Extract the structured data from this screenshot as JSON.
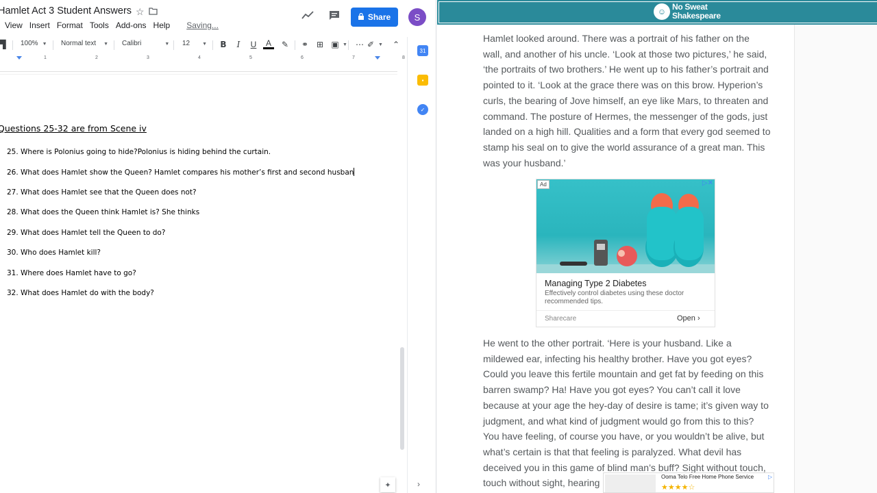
{
  "docs": {
    "title": "Hamlet Act 3 Student Answers",
    "menu": [
      "View",
      "Insert",
      "Format",
      "Tools",
      "Add-ons",
      "Help"
    ],
    "saving": "Saving...",
    "share_label": "Share",
    "avatar_letter": "S",
    "toolbar": {
      "zoom": "100%",
      "style": "Normal text",
      "font": "Calibri",
      "size": "12"
    },
    "ruler_ticks": [
      "1",
      "2",
      "3",
      "4",
      "5",
      "6",
      "7",
      "8"
    ],
    "heading": "Questions 25-32 are from Scene iv",
    "questions": [
      "25. Where is Polonius going to hide?Polonius is hiding behind the curtain.",
      "26. What does Hamlet show the Queen? Hamlet compares his mother’s first and second husban",
      "27. What does Hamlet see that the Queen does not?",
      "28. What does the Queen think Hamlet is? She thinks",
      "29. What does Hamlet tell the Queen to do?",
      "30.  Who does Hamlet kill?",
      "31. Where does Hamlet have to go?",
      "32. What does Hamlet do with the body?"
    ]
  },
  "site": {
    "logo_line1": "No Sweat",
    "logo_line2": "Shakespeare",
    "paragraph1": "Hamlet looked around. There was a portrait of his father on the wall, and another of his uncle. ‘Look at those two pictures,’ he said, ‘the portraits of two brothers.’ He went up to his father’s portrait and pointed to it. ‘Look at the grace there was on this brow. Hyperion’s curls, the bearing of Jove himself, an eye like Mars, to threaten and command. The posture of Hermes, the messenger of the gods, just landed on a high hill. Qualities and a form that every god seemed to stamp his seal on to give the world assurance of a great man. This was your husband.’",
    "paragraph2": "He went to the other portrait. ‘Here is your husband. Like a mildewed ear, infecting his healthy brother. Have you got eyes? Could you leave this fertile mountain and get fat by feeding on this barren swamp? Ha! Have you got eyes? You can’t call it love because at your age the hey-day of desire is tame; it’s given way to judgment, and what kind of judgment would go from this to this? You have feeling, of course you have, or you wouldn’t be alive, but what’s certain is that that feeling is paralyzed. What devil has deceived you in this game of blind man’s buff? Sight without touch, touch without sight, hearing",
    "ad": {
      "badge": "Ad",
      "title": "Managing Type 2 Diabetes",
      "description": "Effectively control diabetes using these doctor recommended tips.",
      "source": "Sharecare",
      "cta": "Open"
    },
    "bottom_ad": {
      "title": "Ooma Telo Free Home Phone Service",
      "rating": "★★★★☆"
    },
    "colors": {
      "header": "#2a8a9a",
      "text": "#55595c",
      "docs_blue": "#1a73e8"
    }
  }
}
